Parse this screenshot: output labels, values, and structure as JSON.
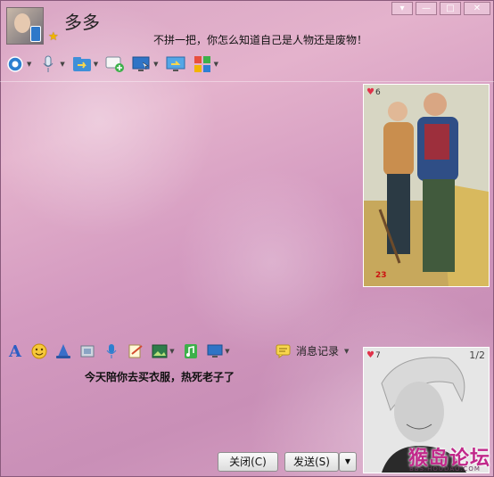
{
  "contact": {
    "name": "多多",
    "signature": "不拼一把，你怎么知道自己是人物还是废物！"
  },
  "window_controls": {
    "skin": "▾",
    "minimize": "—",
    "maximize": "□",
    "close": "✕"
  },
  "toolbar": {
    "items": [
      {
        "icon": "webcam-icon"
      },
      {
        "icon": "microphone-icon"
      },
      {
        "icon": "folder-transfer-icon"
      },
      {
        "icon": "message-add-icon"
      },
      {
        "icon": "remote-desktop-icon"
      },
      {
        "icon": "screen-share-icon"
      },
      {
        "icon": "app-grid-icon"
      }
    ]
  },
  "input_toolbar": {
    "font": "A",
    "history_label": "消息记录"
  },
  "message_input": {
    "text": "今天陪你去买衣服，热死老子了"
  },
  "video": {
    "remote_badge": "6",
    "remote_counter": "23",
    "self_badge": "7",
    "page_indicator": "1/2"
  },
  "watermark": {
    "text": "猴岛论坛",
    "url": "BBS.HOUDAO.COM"
  },
  "buttons": {
    "close": "关闭(C)",
    "send": "发送(S)",
    "send_options": "▼"
  }
}
